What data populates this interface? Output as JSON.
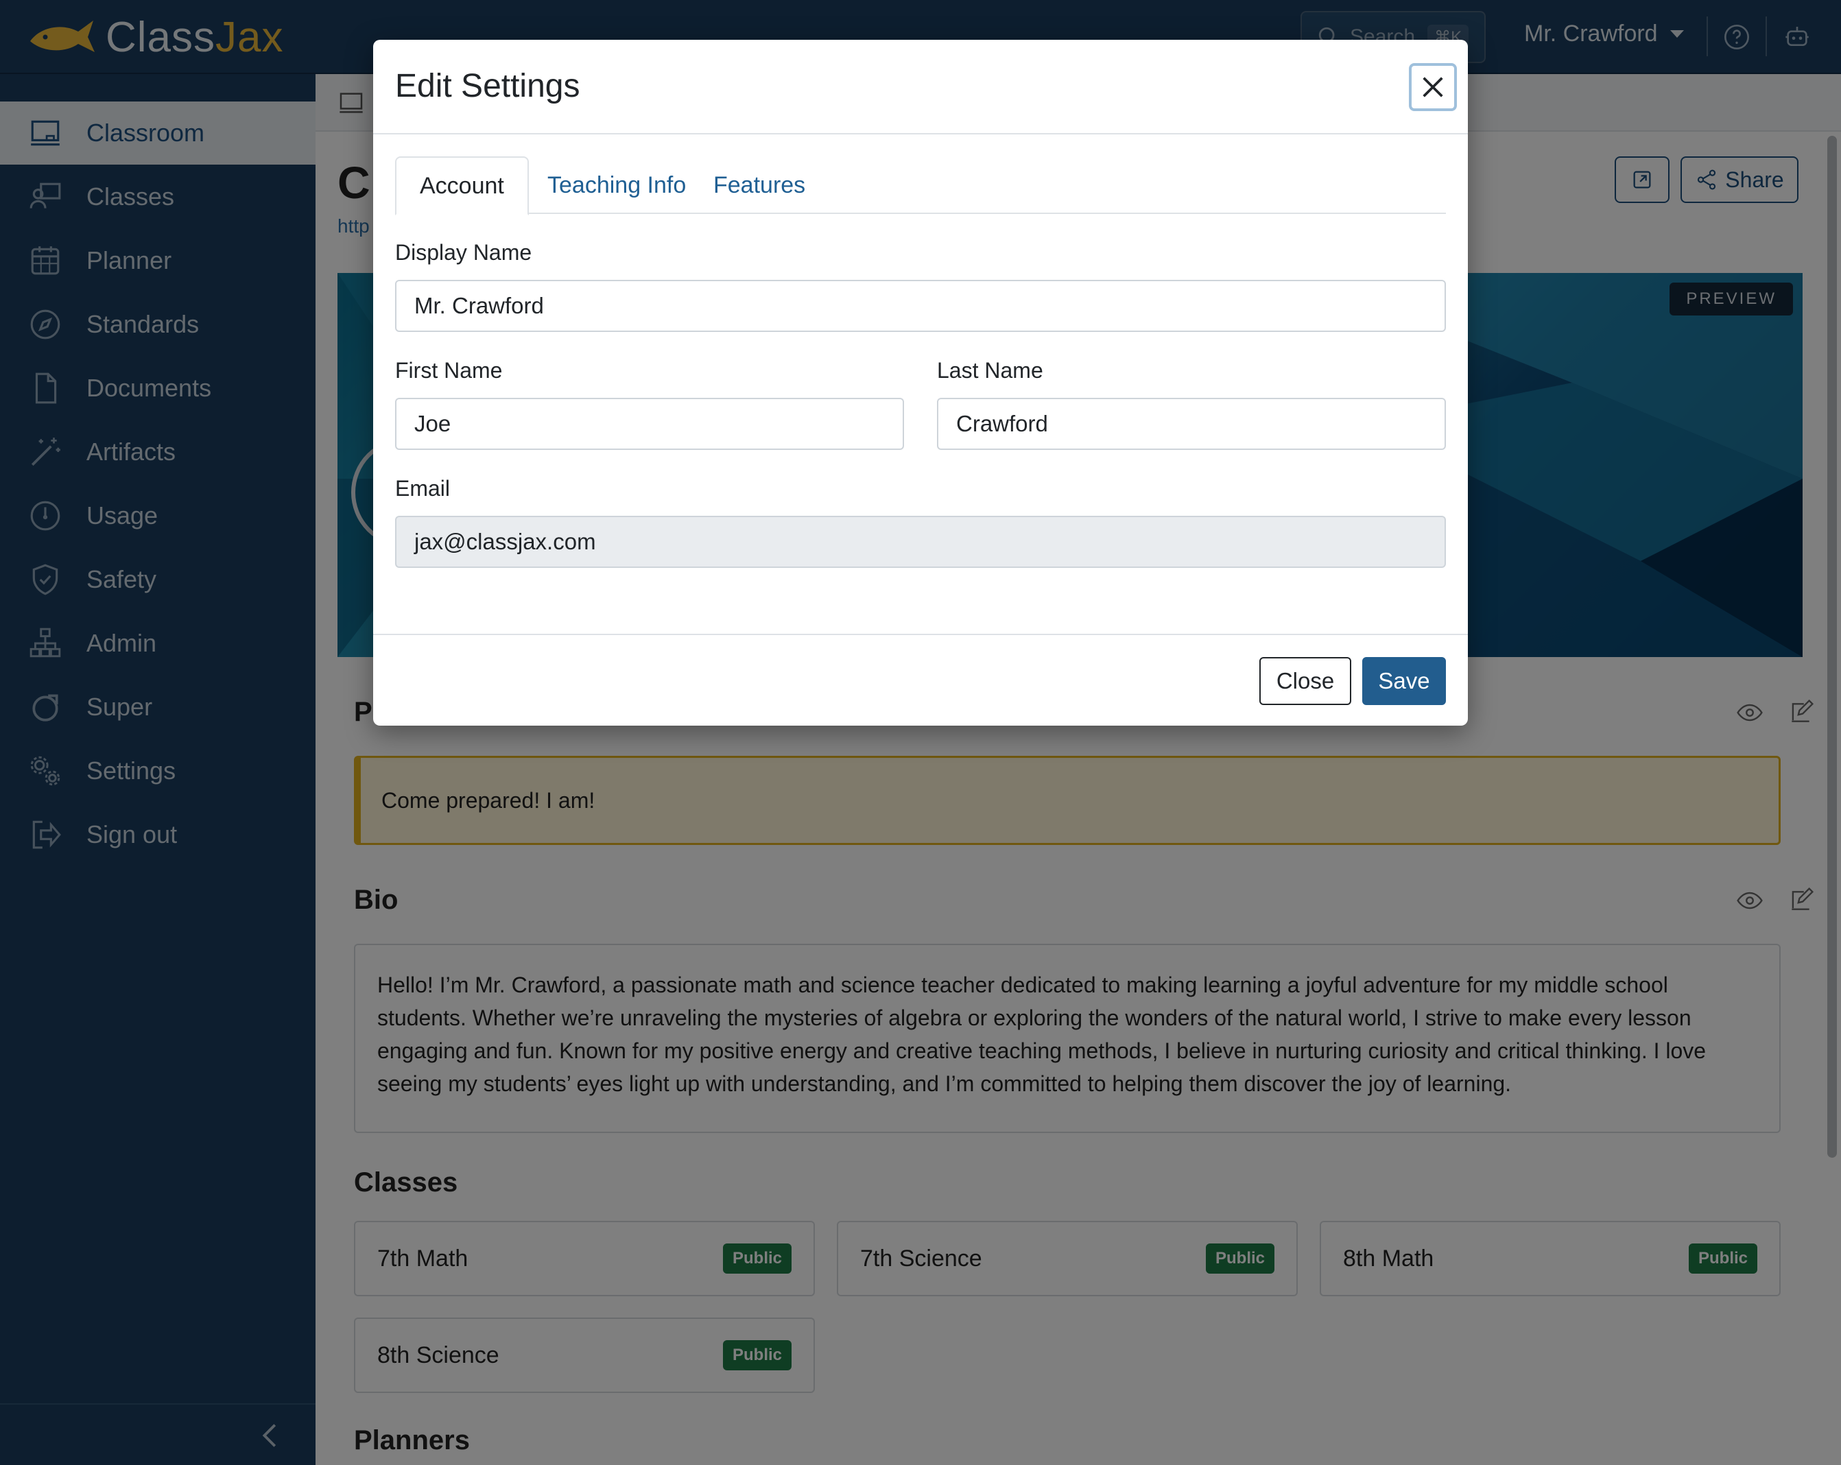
{
  "app": {
    "logo_text_a": "Class",
    "logo_text_b": "Jax",
    "brand_color": "#e8b73b",
    "primary_color": "#1a3d5f"
  },
  "topbar": {
    "search_placeholder": "Search",
    "search_shortcut": "⌘K",
    "user_name": "Mr. Crawford"
  },
  "sidebar": {
    "items": [
      {
        "label": "Classroom",
        "icon": "chalkboard-icon"
      },
      {
        "label": "Classes",
        "icon": "teacher-icon"
      },
      {
        "label": "Planner",
        "icon": "calendar-icon"
      },
      {
        "label": "Standards",
        "icon": "compass-icon"
      },
      {
        "label": "Documents",
        "icon": "document-icon"
      },
      {
        "label": "Artifacts",
        "icon": "magic-wand-icon"
      },
      {
        "label": "Usage",
        "icon": "gauge-icon"
      },
      {
        "label": "Safety",
        "icon": "shield-check-icon"
      },
      {
        "label": "Admin",
        "icon": "org-chart-icon"
      },
      {
        "label": "Super",
        "icon": "ring-icon"
      },
      {
        "label": "Settings",
        "icon": "gears-icon"
      },
      {
        "label": "Sign out",
        "icon": "sign-out-icon"
      }
    ]
  },
  "page": {
    "title": "Cl",
    "url": "http",
    "share_label": "Share",
    "preview_badge": "PREVIEW",
    "policy_title": "P",
    "policy_text": "Come prepared! I am!",
    "bio_title": "Bio",
    "bio_text": "Hello! I’m Mr. Crawford, a passionate math and science teacher dedicated to making learning a joyful adventure for my middle school students. Whether we’re unraveling the mysteries of algebra or exploring the wonders of the natural world, I strive to make every lesson engaging and fun. Known for my positive energy and creative teaching methods, I believe in nurturing curiosity and critical thinking. I love seeing my students’ eyes light up with understanding, and I’m committed to helping them discover the joy of learning.",
    "classes_title": "Classes",
    "classes": [
      {
        "name": "7th Math",
        "badge": "Public"
      },
      {
        "name": "7th Science",
        "badge": "Public"
      },
      {
        "name": "8th Math",
        "badge": "Public"
      },
      {
        "name": "8th Science",
        "badge": "Public"
      }
    ],
    "planners_title": "Planners"
  },
  "modal": {
    "title": "Edit Settings",
    "tabs": [
      {
        "label": "Account"
      },
      {
        "label": "Teaching Info"
      },
      {
        "label": "Features"
      }
    ],
    "display_name_label": "Display Name",
    "display_name_value": "Mr. Crawford",
    "first_name_label": "First Name",
    "first_name_value": "Joe",
    "last_name_label": "Last Name",
    "last_name_value": "Crawford",
    "email_label": "Email",
    "email_value": "jax@classjax.com",
    "close_label": "Close",
    "save_label": "Save"
  }
}
